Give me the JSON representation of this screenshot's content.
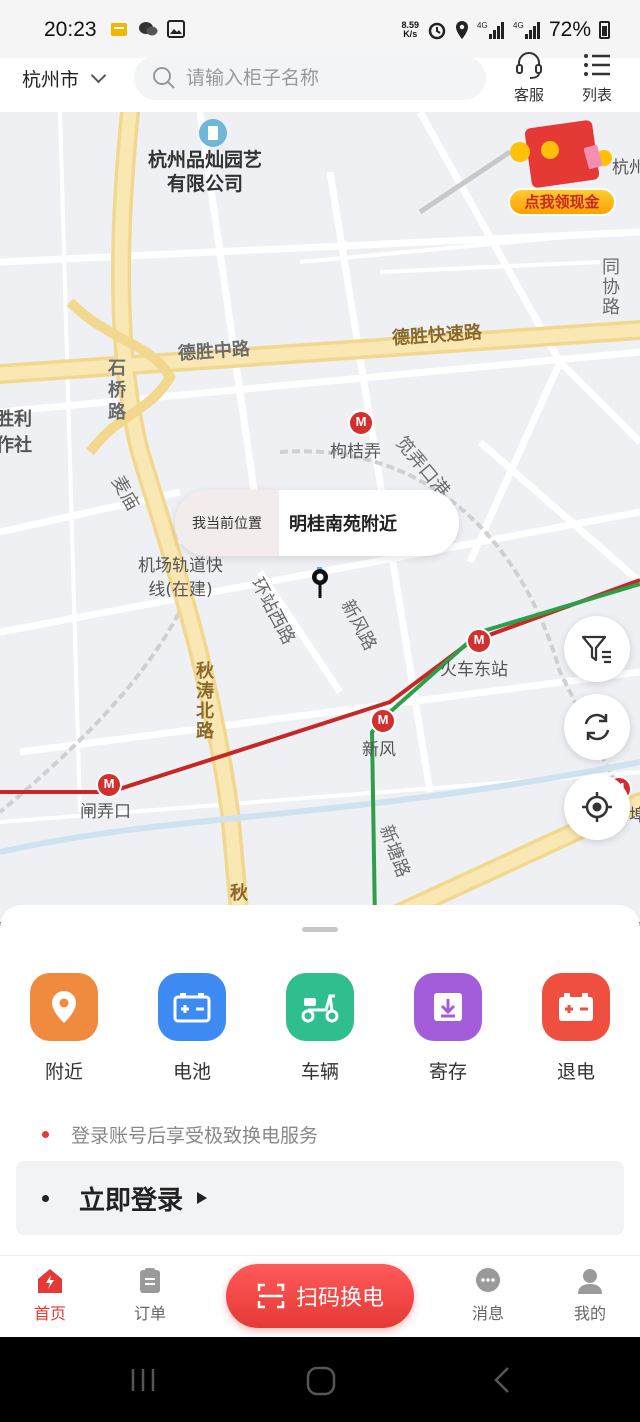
{
  "status_bar": {
    "time": "20:23",
    "net_speed_value": "8.59",
    "net_speed_unit": "K/s",
    "battery": "72%"
  },
  "header": {
    "city": "杭州市",
    "search_placeholder": "请输入柜子名称",
    "service_label": "客服",
    "list_label": "列表"
  },
  "map": {
    "labels": {
      "poi_company_line1": "杭州品灿园艺",
      "poi_company_line2": "有限公司",
      "desheng_middle_rd": "德胜中路",
      "desheng_expressway": "德胜快速路",
      "shiqiao_rd": "石桥路",
      "gouju_lane": "枸桔弄",
      "jianshu_port": "笕弄口港",
      "tongxie_rd": "同协路",
      "left_edge_1": "胜利",
      "left_edge_2": "作社",
      "maidao_rd": "麦庙",
      "airport_rail_line1": "机场轨道快",
      "airport_rail_line2": "线(在建)",
      "huanzhan_west_rd": "环站西路",
      "xinfeng_rd": "新风路",
      "railway_east_station": "火车东站",
      "qiutao_north_rd": "秋涛北路",
      "xinfeng_station": "新风",
      "zhanongkou_station": "闸弄口",
      "xintang_rd": "新塘路",
      "qiu": "秋",
      "right_edge_station": "彭埠",
      "right_edge_top": "杭州"
    },
    "current_location_tag": "我当前位置",
    "current_location_name": "明桂南苑附近",
    "promo_label": "点我领现金"
  },
  "quick_actions": [
    {
      "label": "附近",
      "color": "#f08a3e",
      "icon": "location-pin-icon"
    },
    {
      "label": "电池",
      "color": "#3d8bf2",
      "icon": "battery-icon"
    },
    {
      "label": "车辆",
      "color": "#2fbf8f",
      "icon": "scooter-icon"
    },
    {
      "label": "寄存",
      "color": "#a35ddb",
      "icon": "storage-icon"
    },
    {
      "label": "退电",
      "color": "#ef4f3f",
      "icon": "return-battery-icon"
    }
  ],
  "login": {
    "hint": "登录账号后享受极致换电服务",
    "button_label": "立即登录"
  },
  "bottom_nav": {
    "home": "首页",
    "orders": "订单",
    "scan": "扫码换电",
    "messages": "消息",
    "mine": "我的"
  },
  "colors": {
    "brand_red": "#e53935",
    "metro_red_line": "#c62828",
    "metro_green_line": "#2e9e49",
    "road_yellow": "#f7e3a3"
  }
}
